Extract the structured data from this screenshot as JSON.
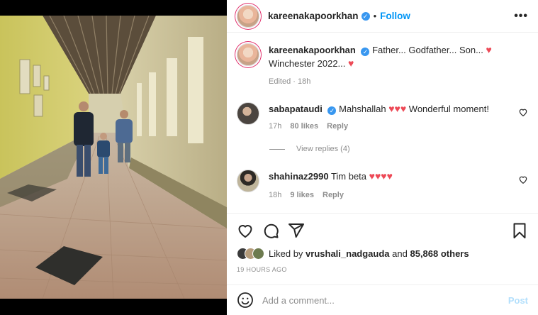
{
  "post": {
    "username": "kareenakapoorkhan",
    "follow_label": "Follow",
    "more_label": "•••"
  },
  "caption": {
    "username": "kareenakapoorkhan",
    "text_1": "Father... Godfather... Son...",
    "text_2": "Winchester 2022...",
    "edited": "Edited",
    "time": "18h"
  },
  "comments": [
    {
      "username": "sabapataudi",
      "text_before": "Mahshallah",
      "text_after": "Wonderful moment!",
      "time": "17h",
      "likes": "80 likes",
      "reply": "Reply"
    },
    {
      "username": "shahinaz2990",
      "text_before": "Tim beta",
      "text_after": "",
      "time": "18h",
      "likes": "9 likes",
      "reply": "Reply"
    }
  ],
  "view_replies": "View replies (4)",
  "likes": {
    "prefix": "Liked by",
    "user": "vrushali_nadgauda",
    "middle": "and",
    "others": "85,868 others"
  },
  "timestamp": "19 HOURS AGO",
  "add_comment": {
    "placeholder": "Add a comment...",
    "post_label": "Post"
  },
  "icons": {
    "heart": "heart-icon",
    "comment": "comment-icon",
    "share": "share-icon",
    "save": "bookmark-icon",
    "emoji": "emoji-icon"
  },
  "colors": {
    "accent": "#0095f6",
    "heart": "#ed4956",
    "verified": "#3897f0",
    "muted": "#8e8e8e"
  }
}
